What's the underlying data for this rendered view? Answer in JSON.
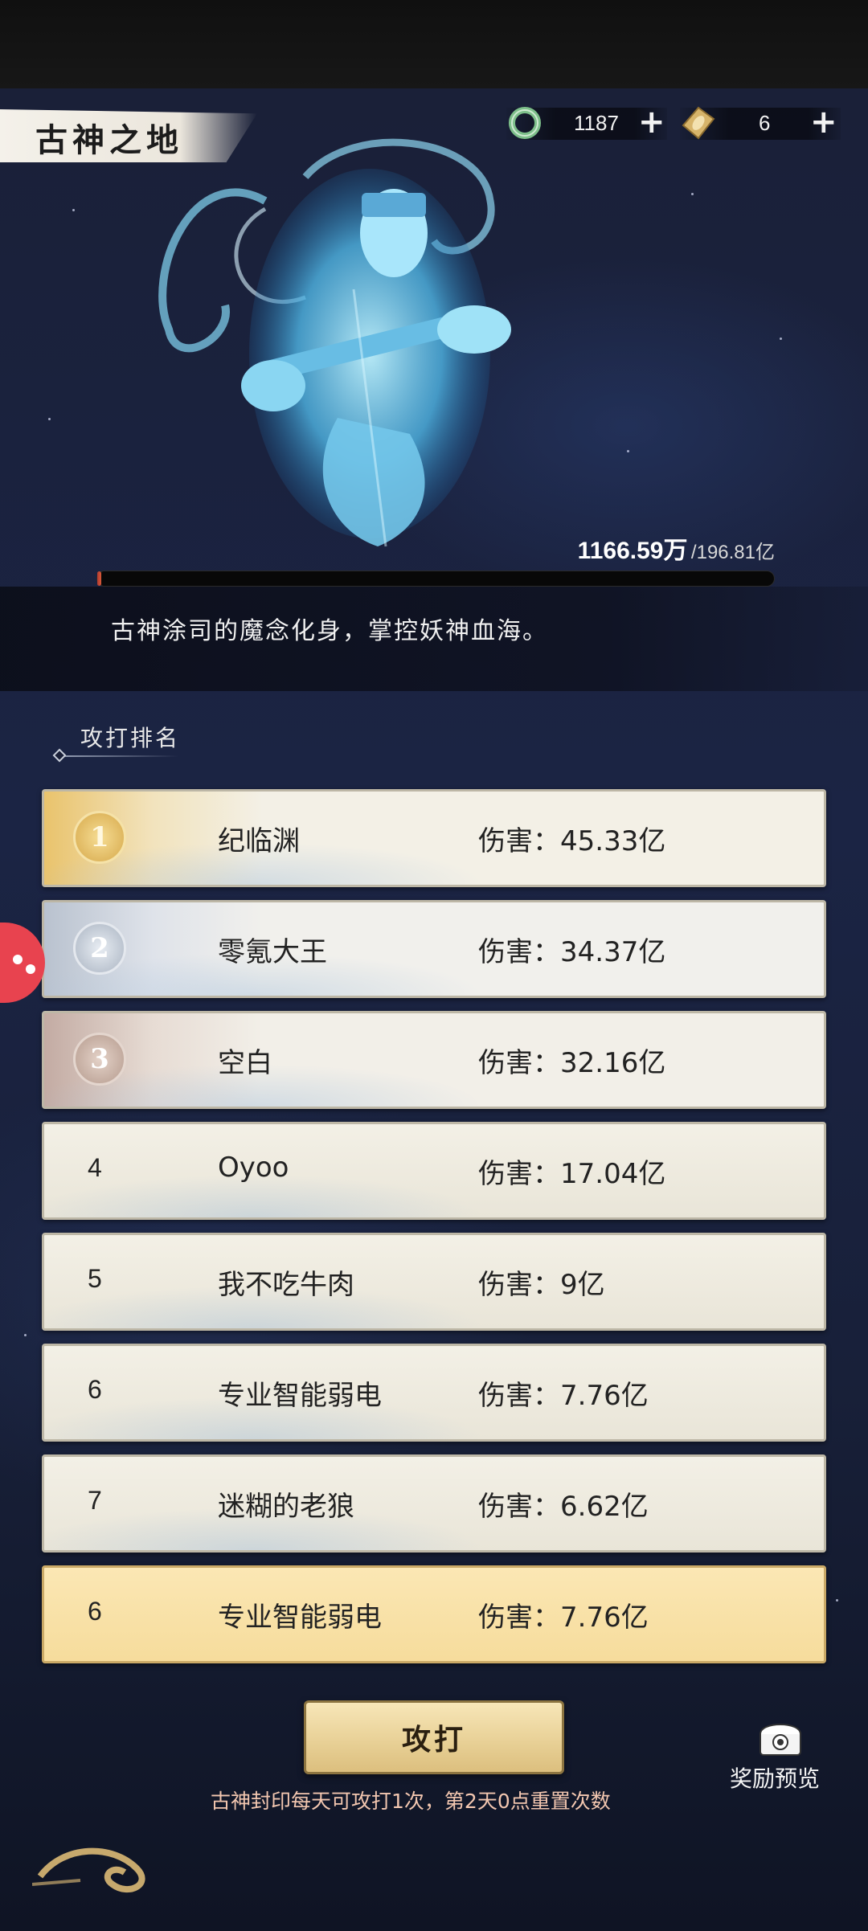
{
  "header": {
    "title": "古神之地"
  },
  "resources": [
    {
      "icon": "jade-ring-icon",
      "value": "1187"
    },
    {
      "icon": "token-card-icon",
      "value": "6"
    }
  ],
  "boss": {
    "hp_current": "1166.59万",
    "hp_max": "/196.81亿",
    "hp_fraction": 0.0059,
    "description": "古神涂司的魔念化身，掌控妖神血海。"
  },
  "ranking": {
    "heading": "攻打排名",
    "rows": [
      {
        "rank": "1",
        "name": "纪临渊",
        "damage": "伤害：45.33亿"
      },
      {
        "rank": "2",
        "name": "零氪大王",
        "damage": "伤害：34.37亿"
      },
      {
        "rank": "3",
        "name": "空白",
        "damage": "伤害：32.16亿"
      },
      {
        "rank": "4",
        "name": "Oyoo",
        "damage": "伤害：17.04亿"
      },
      {
        "rank": "5",
        "name": "我不吃牛肉",
        "damage": "伤害：9亿"
      },
      {
        "rank": "6",
        "name": "专业智能弱电",
        "damage": "伤害：7.76亿"
      },
      {
        "rank": "7",
        "name": "迷糊的老狼",
        "damage": "伤害：6.62亿"
      }
    ],
    "mine": {
      "rank": "6",
      "name": "专业智能弱电",
      "damage": "伤害：7.76亿"
    }
  },
  "actions": {
    "attack_label": "攻打",
    "note": "古神封印每天可攻打1次，第2天0点重置次数",
    "reward_label": "奖励预览"
  }
}
